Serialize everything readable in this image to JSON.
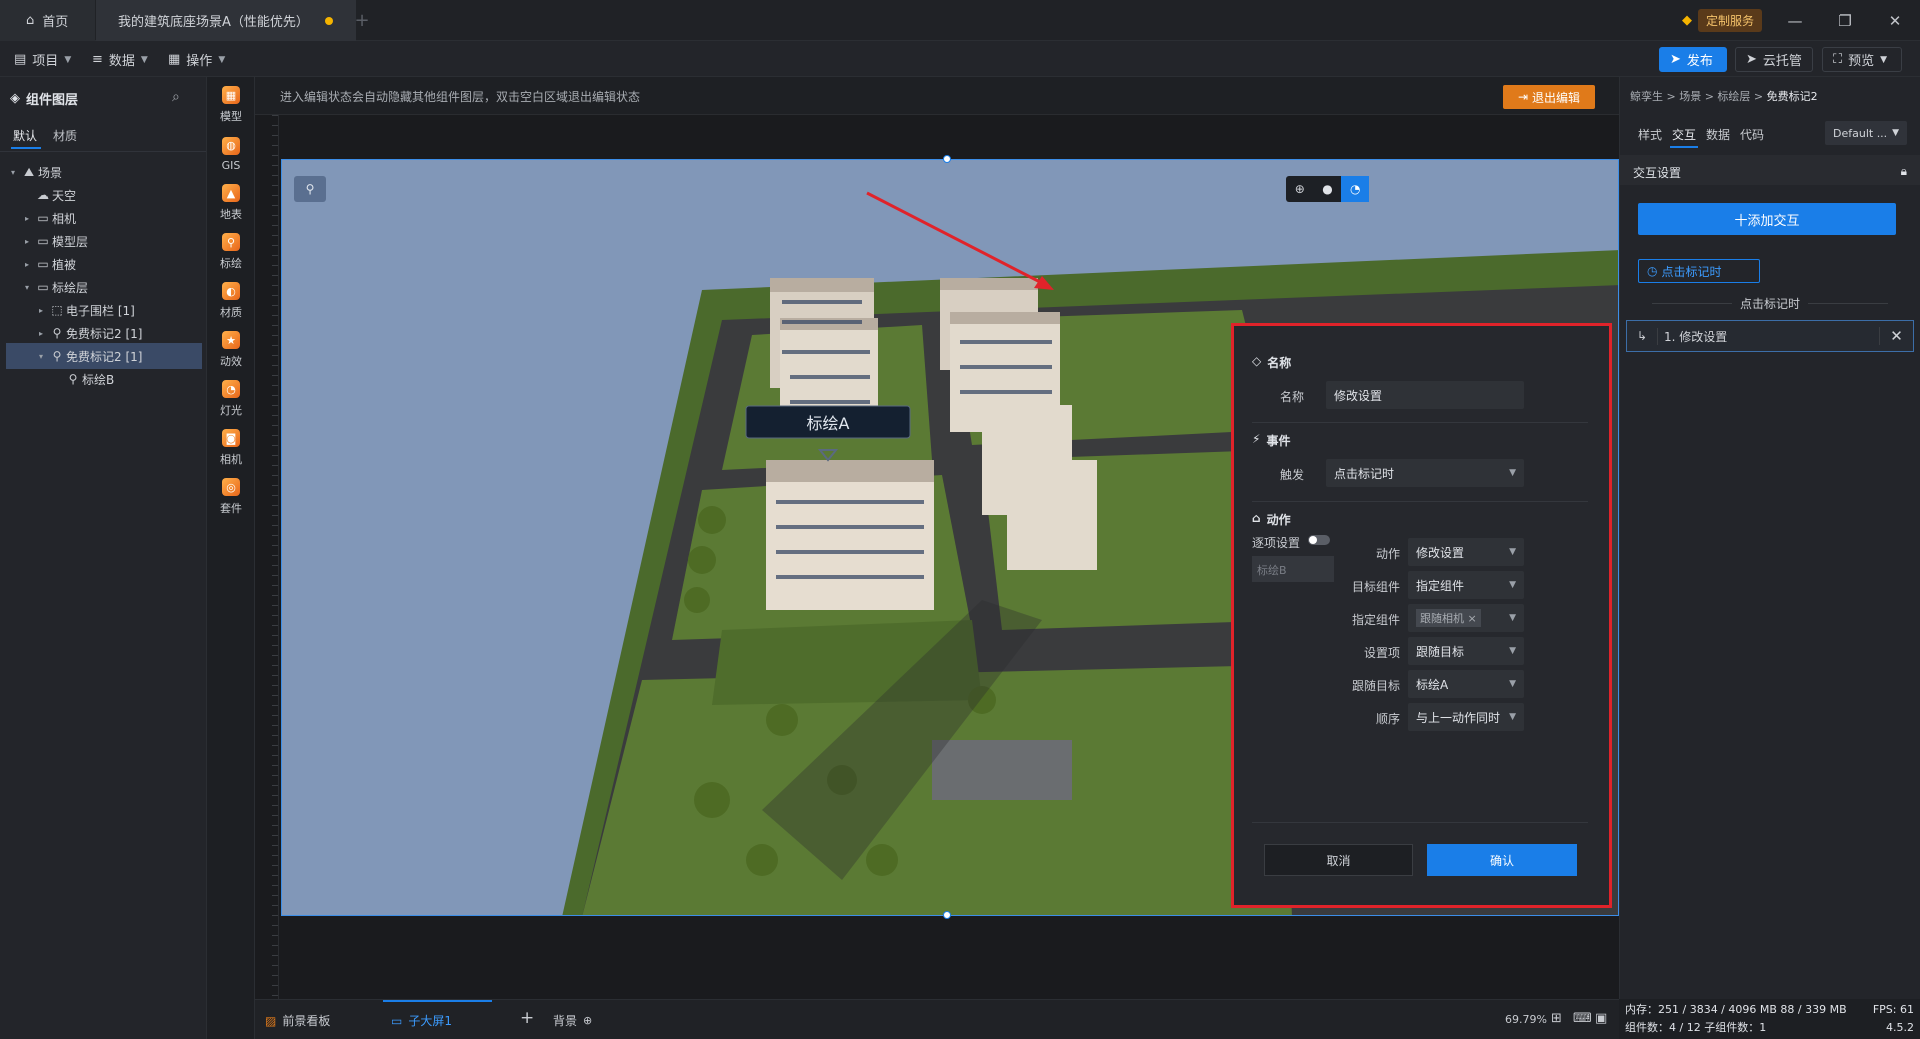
{
  "titlebar": {
    "home_tab": "首页",
    "scene_tab": "我的建筑底座场景A（性能优先）",
    "custom_service": "定制服务"
  },
  "menubar": {
    "project": "项目",
    "data": "数据",
    "operation": "操作",
    "publish": "发布",
    "cloud": "云托管",
    "preview": "预览"
  },
  "left_panel": {
    "title": "组件图层",
    "tabs": [
      "默认",
      "材质"
    ],
    "tree": [
      {
        "label": "场景",
        "icon": "scene-icon",
        "toggle": "▾"
      },
      {
        "label": "天空",
        "icon": "sky-icon",
        "toggle": ""
      },
      {
        "label": "相机",
        "icon": "folder-icon",
        "toggle": "▸"
      },
      {
        "label": "模型层",
        "icon": "folder-icon",
        "toggle": "▸"
      },
      {
        "label": "植被",
        "icon": "folder-icon",
        "toggle": "▸"
      },
      {
        "label": "标绘层",
        "icon": "folder-icon",
        "toggle": "▾"
      },
      {
        "label": "电子围栏 [1]",
        "icon": "fence-icon",
        "toggle": "▸"
      },
      {
        "label": "免费标记2 [1]",
        "icon": "marker-icon",
        "toggle": "▸"
      },
      {
        "label": "免费标记2 [1]",
        "icon": "marker-icon",
        "toggle": "▾"
      },
      {
        "label": "标绘B",
        "icon": "marker-icon",
        "toggle": ""
      }
    ]
  },
  "toolbar": {
    "tools": [
      "模型",
      "GIS",
      "地表",
      "标绘",
      "材质",
      "动效",
      "灯光",
      "相机",
      "套件"
    ]
  },
  "editor": {
    "tip": "进入编辑状态会自动隐藏其他组件图层，双击空白区域退出编辑状态",
    "exit_edit": "退出编辑",
    "marker_label": "标绘A"
  },
  "dialog": {
    "name_section": "名称",
    "name_label": "名称",
    "name_value": "修改设置",
    "event_section": "事件",
    "trigger_label": "触发",
    "trigger_value": "点击标记时",
    "action_section": "动作",
    "item_setting": "逐项设置",
    "item_placeholder": "标绘B",
    "rows": [
      {
        "label": "动作",
        "value": "修改设置"
      },
      {
        "label": "目标组件",
        "value": "指定组件"
      },
      {
        "label": "指定组件",
        "value": "跟随相机 ×"
      },
      {
        "label": "设置项",
        "value": "跟随目标"
      },
      {
        "label": "跟随目标",
        "value": "标绘A"
      },
      {
        "label": "顺序",
        "value": "与上一动作同时"
      }
    ],
    "cancel": "取消",
    "confirm": "确认"
  },
  "bottom_bar": {
    "front_board": "前景看板",
    "sub_screen": "子大屏1",
    "background": "背景",
    "zoom": "69.79%"
  },
  "right_panel": {
    "breadcrumb": "鲸孪生 > 场景 > 标绘层 > ",
    "breadcrumb_current": "免费标记2",
    "tabs": [
      "样式",
      "交互",
      "数据",
      "代码"
    ],
    "default_select": "Default ...",
    "section": "交互设置",
    "add_interaction": "十添加交互",
    "marker_click_tag": "点击标记时",
    "sub_title": "点击标记时",
    "action_item": "1. 修改设置"
  },
  "status": {
    "memory": "内存：251 / 3834 / 4096 MB  88 / 339 MB",
    "fps": "FPS:  61",
    "components": "组件数：4 / 12    子组件数：1",
    "version": "4.5.2"
  }
}
